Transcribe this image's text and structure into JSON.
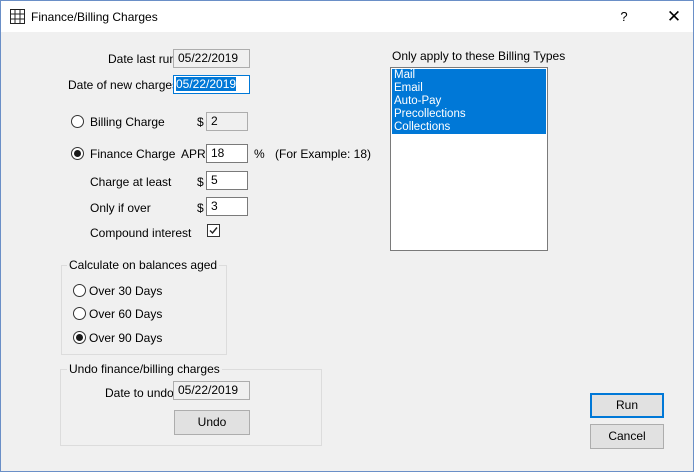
{
  "window": {
    "title": "Finance/Billing Charges",
    "help_label": "?",
    "close_label": "✕"
  },
  "dates": {
    "last_run_label": "Date last run",
    "last_run_value": "05/22/2019",
    "new_charges_label": "Date of new charges",
    "new_charges_value": "05/22/2019"
  },
  "billing_charge": {
    "label": "Billing Charge",
    "selected": false,
    "currency": "$",
    "value": "2"
  },
  "finance_charge": {
    "label": "Finance Charge",
    "selected": true,
    "apr_label": "APR",
    "apr_value": "18",
    "percent": "%",
    "example": "(For Example: 18)",
    "charge_at_least_label": "Charge at least",
    "charge_at_least_currency": "$",
    "charge_at_least_value": "5",
    "only_if_over_label": "Only if over",
    "only_if_over_currency": "$",
    "only_if_over_value": "3",
    "compound_label": "Compound interest",
    "compound_checked": true
  },
  "aging": {
    "title": "Calculate on balances aged",
    "options": [
      {
        "label": "Over 30 Days",
        "selected": false
      },
      {
        "label": "Over 60 Days",
        "selected": false
      },
      {
        "label": "Over 90 Days",
        "selected": true
      }
    ]
  },
  "undo": {
    "title": "Undo finance/billing charges",
    "date_label": "Date to undo",
    "date_value": "05/22/2019",
    "button_label": "Undo"
  },
  "billing_types": {
    "title": "Only apply to these Billing Types",
    "items": [
      "Mail",
      "Email",
      "Auto-Pay",
      "Precollections",
      "Collections"
    ]
  },
  "actions": {
    "run_label": "Run",
    "cancel_label": "Cancel"
  }
}
